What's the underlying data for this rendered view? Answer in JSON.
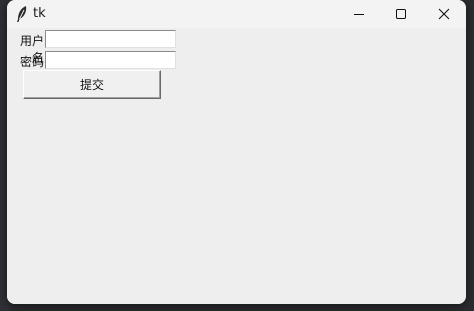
{
  "window": {
    "title": "tk",
    "controls": {
      "minimize_icon": "minimize-icon",
      "maximize_icon": "maximize-icon",
      "close_icon": "close-icon"
    }
  },
  "form": {
    "username_label": "用户名",
    "username_value": "",
    "password_label": "密码",
    "password_value": "",
    "submit_label": "提交"
  },
  "colors": {
    "window_bg": "#eeeeee",
    "titlebar_bg": "#f3f3f3",
    "entry_bg": "#ffffff"
  }
}
